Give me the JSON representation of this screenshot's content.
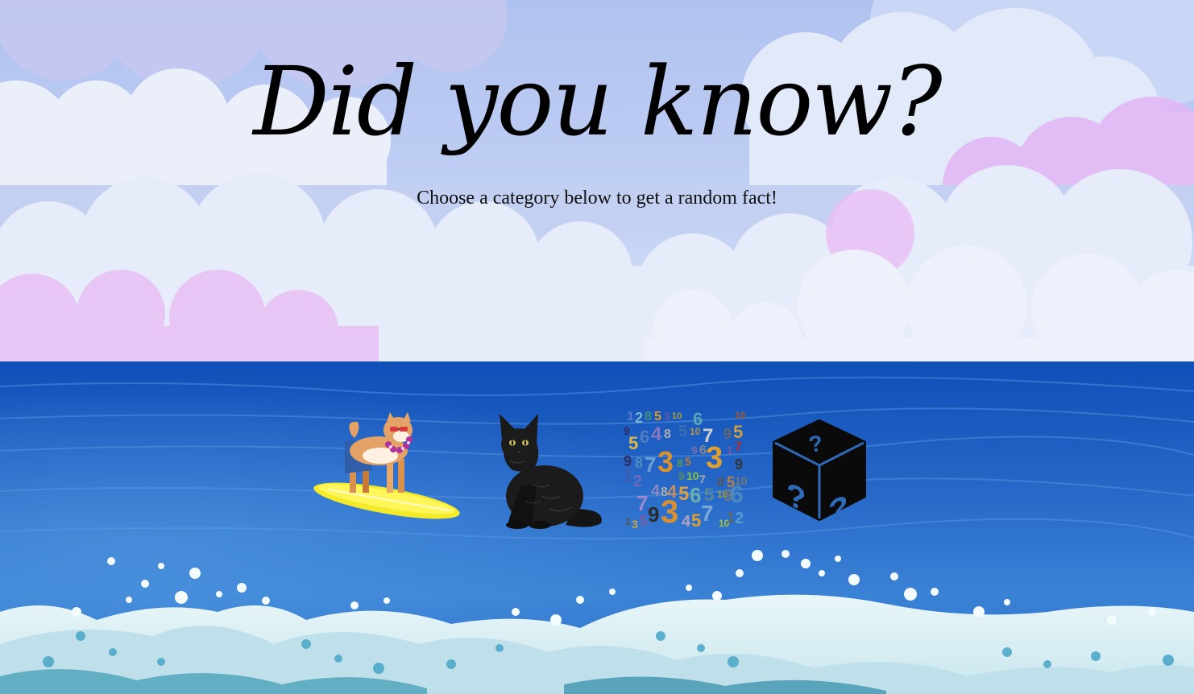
{
  "header": {
    "title": "Did you know?",
    "subtitle": "Choose a category below to get a random fact!"
  },
  "categories": [
    {
      "id": "dog",
      "icon": "surfing-dog-icon"
    },
    {
      "id": "cat",
      "icon": "black-cat-icon"
    },
    {
      "id": "number",
      "icon": "numbers-icon"
    },
    {
      "id": "random",
      "icon": "mystery-box-icon"
    }
  ],
  "colors": {
    "sky_top": "#b3c3f0",
    "sky_bottom": "#e8eefa",
    "cloud_pink": "#e6c3f2",
    "ocean_top": "#1a56c0",
    "ocean_mid": "#2e74d0",
    "foam": "#dff1f6"
  }
}
